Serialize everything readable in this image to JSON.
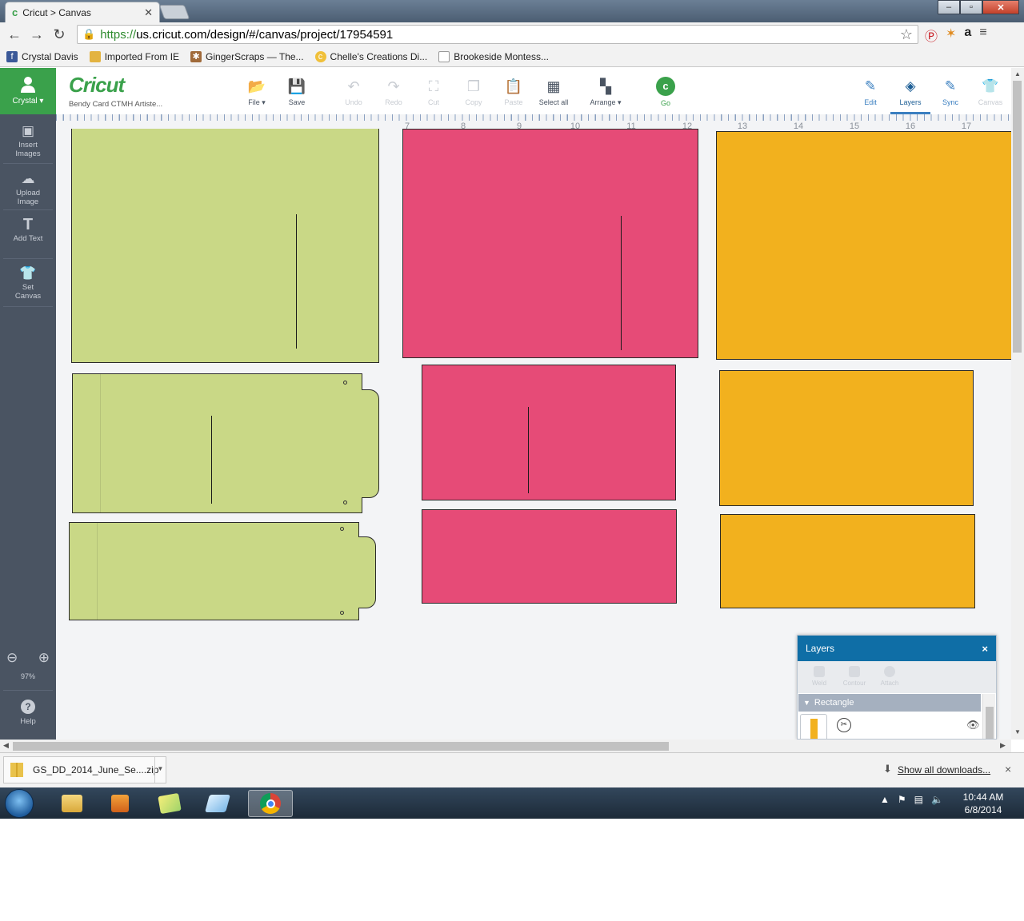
{
  "browser": {
    "tab_title": "Cricut > Canvas",
    "tab_icon": "c",
    "url_https": "https://",
    "url_rest": "us.cricut.com/design/#/canvas/project/17954591",
    "window_controls": [
      "–",
      "▫",
      "✕"
    ],
    "bookmarks": [
      {
        "label": "Crystal Davis",
        "icon": "f",
        "color": "#3b5998"
      },
      {
        "label": "Imported From IE",
        "icon": "",
        "color": "#e3b341"
      },
      {
        "label": "GingerScraps — The...",
        "icon": "✱",
        "color": "#a06a3a"
      },
      {
        "label": "Chelle's Creations Di...",
        "icon": "c",
        "color": "#f0c03a"
      },
      {
        "label": "Brookeside Montess...",
        "icon": "",
        "color": "#dddddd"
      }
    ]
  },
  "app": {
    "logo": "Cricut",
    "project_name": "Bendy Card CTMH Artiste...",
    "user_name": "Crystal ▾",
    "sidebar": [
      {
        "label": "Insert Images",
        "icon": "image-icon"
      },
      {
        "label": "Upload Image",
        "icon": "upload-icon"
      },
      {
        "label": "Add Text",
        "icon": "text-icon"
      },
      {
        "label": "Set Canvas",
        "icon": "shirt-icon"
      }
    ],
    "zoom_level": "97%",
    "help_label": "Help",
    "tools": [
      {
        "label": "File ▾",
        "icon": "folder-icon",
        "enabled": true
      },
      {
        "label": "Save",
        "icon": "save-icon",
        "enabled": true
      },
      {
        "label": "Undo",
        "icon": "undo-icon",
        "enabled": false
      },
      {
        "label": "Redo",
        "icon": "redo-icon",
        "enabled": false
      },
      {
        "label": "Cut",
        "icon": "cut-icon",
        "enabled": false
      },
      {
        "label": "Copy",
        "icon": "copy-icon",
        "enabled": false
      },
      {
        "label": "Paste",
        "icon": "paste-icon",
        "enabled": false
      },
      {
        "label": "Select all",
        "icon": "select-all-icon",
        "enabled": true
      },
      {
        "label": "Arrange ▾",
        "icon": "arrange-icon",
        "enabled": true
      },
      {
        "label": "Go",
        "icon": "go-icon",
        "enabled": true
      }
    ],
    "right_tools": [
      {
        "label": "Edit",
        "icon": "edit-icon",
        "state": "normal"
      },
      {
        "label": "Layers",
        "icon": "layers-icon",
        "state": "active"
      },
      {
        "label": "Sync",
        "icon": "sync-icon",
        "state": "normal"
      },
      {
        "label": "Canvas",
        "icon": "canvas-icon",
        "state": "disabled"
      }
    ],
    "ruler_numbers": [
      "7",
      "8",
      "9",
      "10",
      "11",
      "12",
      "13",
      "14",
      "15",
      "16",
      "17"
    ],
    "colors": {
      "green": "#c9d886",
      "pink": "#e64b77",
      "orange": "#f2b11e",
      "brand": "#3aa14b",
      "panel_header": "#0f6ea6"
    }
  },
  "layers_panel": {
    "title": "Layers",
    "close": "×",
    "actions": [
      "Weld",
      "Contour",
      "Attach"
    ],
    "group_label": "Rectangle",
    "layer_icons": [
      "cut-icon",
      "eye-icon"
    ]
  },
  "downloads": {
    "file_name": "GS_DD_2014_June_Se....zip",
    "show_all": "Show all downloads...",
    "close": "×"
  },
  "taskbar": {
    "time": "10:44 AM",
    "date": "6/8/2014",
    "apps": [
      "explorer-icon",
      "media-player-icon",
      "sticky-notes-icon",
      "notepad-icon",
      "chrome-icon"
    ]
  }
}
